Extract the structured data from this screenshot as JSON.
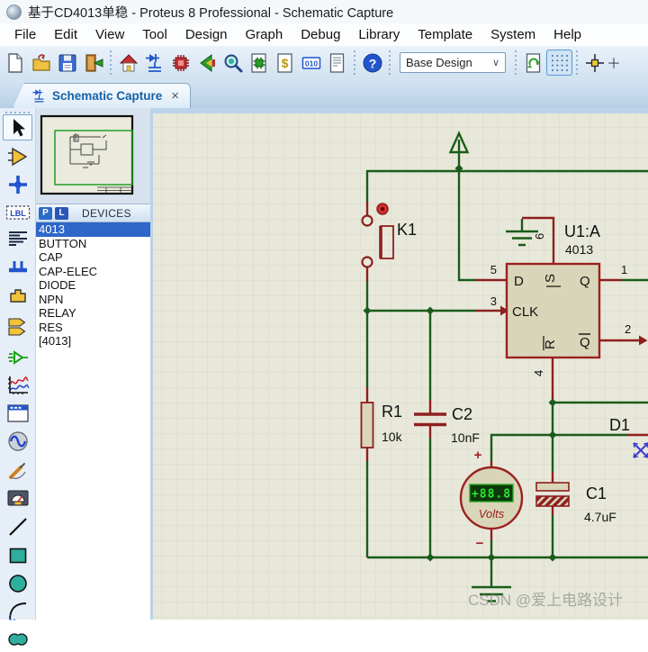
{
  "window": {
    "title": "基于CD4013单稳 - Proteus 8 Professional - Schematic Capture"
  },
  "menu_bar": {
    "items": [
      "File",
      "Edit",
      "View",
      "Tool",
      "Design",
      "Graph",
      "Debug",
      "Library",
      "Template",
      "System",
      "Help"
    ]
  },
  "toolbar": {
    "design_combo": {
      "value": "Base Design",
      "chevron": "∨"
    },
    "icon_names": [
      "new-file",
      "open-file",
      "save",
      "import-project",
      "home",
      "schematic-capture",
      "pcb-layout",
      "view-back",
      "3d-viewer",
      "design-explorer",
      "bill-of-materials",
      "simulation",
      "design-notes",
      "help",
      "redraw-sheet",
      "grid-toggle",
      "origin",
      "axis"
    ],
    "glyphs": {
      "bom": "$",
      "simulate": "010",
      "help": "?"
    }
  },
  "tabs": {
    "active": {
      "label": "Schematic Capture",
      "close": "×"
    }
  },
  "sidebar_tools": [
    "selection-mode",
    "component-mode",
    "junction-dot-mode",
    "wire-label-mode",
    "text-script-mode",
    "buses-mode",
    "subcircuit-mode",
    "terminals-mode",
    "device-pins-mode",
    "graph-mode",
    "tape-recorder-mode",
    "generator-mode",
    "voltage-probe-mode",
    "virtual-instruments-mode",
    "2d-line",
    "2d-box",
    "2d-circle",
    "2d-arc",
    "2d-path"
  ],
  "sidebar_glyphs": {
    "label_tool": "LBL"
  },
  "devices_panel": {
    "pick_button": "P",
    "library_button": "L",
    "header": "DEVICES",
    "selected": "4013",
    "items": [
      "4013",
      "BUTTON",
      "CAP",
      "CAP-ELEC",
      "DIODE",
      "NPN",
      "RELAY",
      "RES",
      "[4013]"
    ]
  },
  "schematic": {
    "k1": {
      "ref": "K1"
    },
    "u1": {
      "ref": "U1:A",
      "part": "4013",
      "pin_names": {
        "d": "D",
        "clk": "CLK",
        "s": "S",
        "r": "R",
        "q": "Q",
        "q_bar": "Q"
      },
      "pin_numbers": {
        "d": "5",
        "clk": "3",
        "s": "6",
        "r": "4",
        "q": "1",
        "q_bar": "2"
      }
    },
    "r1": {
      "ref": "R1",
      "value": "10k"
    },
    "c2": {
      "ref": "C2",
      "value": "10nF"
    },
    "c1": {
      "ref": "C1",
      "value": "4.7uF"
    },
    "d1": {
      "ref": "D1"
    },
    "voltmeter": {
      "reading": "+88.8",
      "label": "Volts",
      "plus": "+",
      "minus": "−"
    },
    "watermark": "CSDN @爱上电路设计"
  },
  "colors": {
    "wire_green": "#1a5c1a",
    "pin_red": "#8e1f1f",
    "component_fill": "#d9d5b8",
    "component_stroke": "#9b2121",
    "canvas_bg": "#e8e8da",
    "grid_line": "#d9d9c9",
    "selection_blue": "#2f66c8",
    "display_bg": "#0c380c",
    "display_text": "#30e830",
    "watermark_gray": "#9c9c9c"
  }
}
